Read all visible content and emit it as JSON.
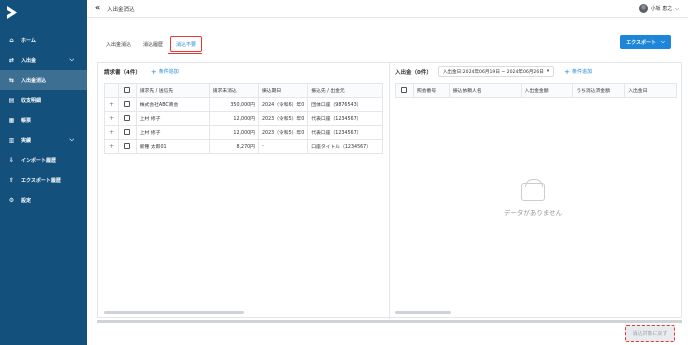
{
  "header": {
    "title": "入出金消込",
    "user_name": "小坂 恵之"
  },
  "sidebar": {
    "items": [
      {
        "label": "ホーム",
        "icon": "home-icon",
        "glyph": "⌂",
        "has_chevron": false,
        "active": false
      },
      {
        "label": "入出金",
        "icon": "transfer-icon",
        "glyph": "⇄",
        "has_chevron": true,
        "active": false
      },
      {
        "label": "入出金消込",
        "icon": "reconcile-icon",
        "glyph": "⇆",
        "has_chevron": false,
        "active": true
      },
      {
        "label": "収支明細",
        "icon": "document-icon",
        "glyph": "▤",
        "has_chevron": false,
        "active": false
      },
      {
        "label": "帳票",
        "icon": "report-icon",
        "glyph": "▦",
        "has_chevron": false,
        "active": false
      },
      {
        "label": "実績",
        "icon": "chart-icon",
        "glyph": "▥",
        "has_chevron": true,
        "active": false
      },
      {
        "label": "インポート履歴",
        "icon": "import-icon",
        "glyph": "⇩",
        "has_chevron": false,
        "active": false
      },
      {
        "label": "エクスポート履歴",
        "icon": "export-icon",
        "glyph": "⇧",
        "has_chevron": false,
        "active": false
      },
      {
        "label": "設定",
        "icon": "gear-icon",
        "glyph": "⚙",
        "has_chevron": false,
        "active": false
      }
    ]
  },
  "tabs": [
    "入出金消込",
    "消込履歴",
    "消込不要"
  ],
  "export_label": "エクスポート",
  "left_panel": {
    "title": "請求書（4件）",
    "add_condition": "条件追加",
    "columns": [
      "請求先 / 送信先",
      "請求未消込",
      "振込期日",
      "振込先 / 出金元"
    ],
    "rows": [
      {
        "name": "株式会社ABC商会",
        "amount": "350,000円",
        "due": "2024（令和6）年0",
        "bank": "団体口座（9876543）"
      },
      {
        "name": "上村 修子",
        "amount": "12,000円",
        "due": "2023（令和5）年0",
        "bank": "代表口座（1234567）"
      },
      {
        "name": "上村 修子",
        "amount": "12,000円",
        "due": "2023（令和5）年0",
        "bank": "代表口座（1234567）"
      },
      {
        "name": "新種 太郎01",
        "amount": "8,270円",
        "due": "-",
        "bank": "口座タイトル（1234567）"
      }
    ]
  },
  "right_panel": {
    "title": "入出金（0件）",
    "date_filter": "入出金日:2024年06月19日 ~ 2024年06月26日",
    "add_condition": "条件追加",
    "columns": [
      "照会番号",
      "振込依頼人名",
      "入出金金額",
      "うち消込済金額",
      "入出金日"
    ],
    "empty_text": "データがありません"
  },
  "confirm_label": "消込対象に戻す",
  "colors": {
    "sidebar": "#13507c",
    "accent": "#1d86d9",
    "highlight": "#e53935"
  }
}
